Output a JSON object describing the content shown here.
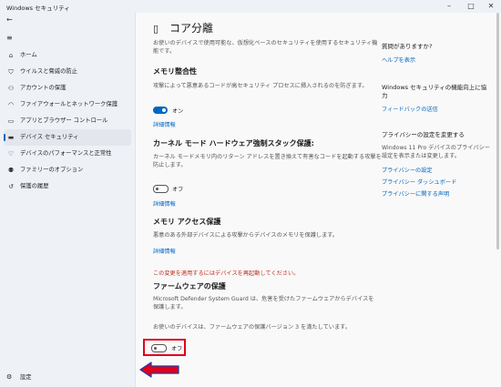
{
  "window": {
    "title": "Windows セキュリティ"
  },
  "nav": {
    "items": [
      {
        "label": "ホーム",
        "icon": "home-icon",
        "glyph": "⌂"
      },
      {
        "label": "ウイルスと脅威の防止",
        "icon": "shield-icon",
        "glyph": "⛉"
      },
      {
        "label": "アカウントの保護",
        "icon": "person-icon",
        "glyph": "⚇"
      },
      {
        "label": "ファイアウォールとネットワーク保護",
        "icon": "wifi-icon",
        "glyph": "◠"
      },
      {
        "label": "アプリとブラウザー コントロール",
        "icon": "app-window-icon",
        "glyph": "▭"
      },
      {
        "label": "デバイス セキュリティ",
        "icon": "laptop-icon",
        "glyph": "▬"
      },
      {
        "label": "デバイスのパフォーマンスと正常性",
        "icon": "heart-icon",
        "glyph": "♡"
      },
      {
        "label": "ファミリーのオプション",
        "icon": "family-icon",
        "glyph": "⚉"
      },
      {
        "label": "保護の履歴",
        "icon": "history-icon",
        "glyph": "↺"
      }
    ],
    "settings_label": "設定"
  },
  "main": {
    "title": "コア分離",
    "intro": [
      "お使いのデバイスで使用可能な、仮想化ベースのセキュリティを使用するセキュリティ機",
      "能です。"
    ],
    "memory_integrity": {
      "heading": "メモリ整合性",
      "desc": "攻撃によって悪意あるコードが高セキュリティ プロセスに挿入されるのを防ぎます。",
      "toggle_state": "オン",
      "link": "詳細情報"
    },
    "stack_protection": {
      "heading": "カーネル モード ハードウェア強制スタック保護:",
      "desc": [
        "カーネル モードメモリ内のリターン アドレスを置き換えて有害なコードを起動する攻撃を",
        "防止します。"
      ],
      "toggle_state": "オフ",
      "link": "詳細情報"
    },
    "memory_access": {
      "heading": "メモリ アクセス保護",
      "desc": "悪意のある外部デバイスによる攻撃からデバイスのメモリを保護します。",
      "link": "詳細情報"
    },
    "restart_warning": "この変更を適用するにはデバイスを再起動してください。",
    "firmware": {
      "heading": "ファームウェアの保護",
      "desc": [
        "Microsoft Defender System Guard は、危害を受けたファームウェアからデバイスを",
        "保護します。"
      ],
      "status": "お使いのデバイスは、ファームウェアの保護バージョン 3 を満たしています。",
      "toggle_state": "オフ"
    }
  },
  "side": {
    "questions": {
      "heading": "質問がありますか?",
      "link": "ヘルプを表示"
    },
    "improve": {
      "heading": [
        "Windows セキュリティの機能向上に協",
        "力"
      ],
      "link": "フィードバックの送信"
    },
    "privacy": {
      "heading": "プライバシーの設定を変更する",
      "text": [
        "Windows 11 Pro デバイスのプライバシー",
        "設定を表示または変更します。"
      ],
      "links": [
        "プライバシーの設定",
        "プライバシー ダッシュボード",
        "プライバシーに関する声明"
      ]
    }
  },
  "colors": {
    "accent": "#0067c0",
    "warning": "#c42b1c",
    "highlight": "#e0001b",
    "sidebar_bg": "#eef1f6",
    "content_bg": "#f9f9f9"
  }
}
